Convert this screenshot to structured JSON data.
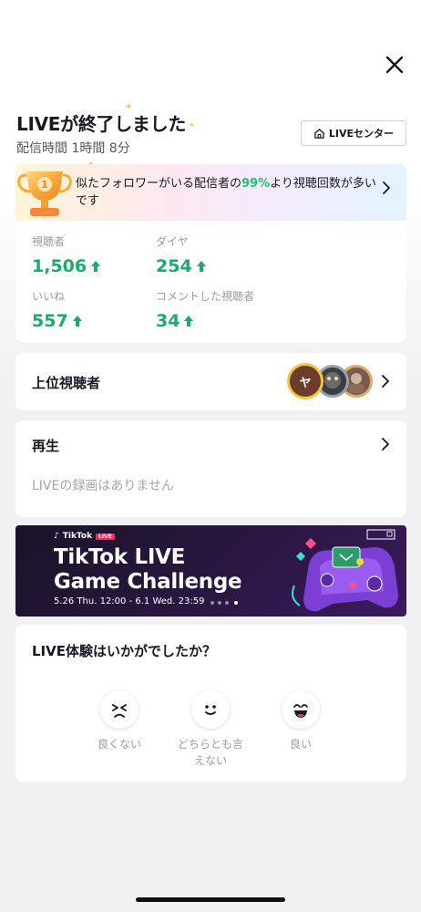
{
  "header": {
    "title": "LIVEが終了しました",
    "duration": "配信時間 1時間 8分",
    "live_center_label": "LIVEセンター"
  },
  "banner": {
    "text_before": "似たフォロワーがいる配信者の",
    "highlight": "99%",
    "text_after": "より視聴回数が多いです"
  },
  "stats": [
    {
      "label": "視聴者",
      "value": "1,506"
    },
    {
      "label": "ダイヤ",
      "value": "254"
    },
    {
      "label": "いいね",
      "value": "557"
    },
    {
      "label": "コメントした視聴者",
      "value": "34"
    }
  ],
  "top_viewers": {
    "title": "上位視聴者",
    "first_avatar_initial": "ヤ"
  },
  "replay": {
    "title": "再生",
    "empty_text": "LIVEの録画はありません"
  },
  "event_banner": {
    "brand": "TikTok",
    "live_tag": "LIVE",
    "title_line1": "TikTok LIVE",
    "title_line2": "Game Challenge",
    "dates": "5.26 Thu. 12:00 - 6.1 Wed. 23:59"
  },
  "rating": {
    "question": "LIVE体験はいかがでしたか？",
    "options": [
      {
        "label": "良くない"
      },
      {
        "label": "どちらとも言えない"
      },
      {
        "label": "良い"
      }
    ]
  },
  "colors": {
    "accent_green": "#1bab6b",
    "highlight_green": "#20c077",
    "tiktok_red": "#fe2c55"
  }
}
